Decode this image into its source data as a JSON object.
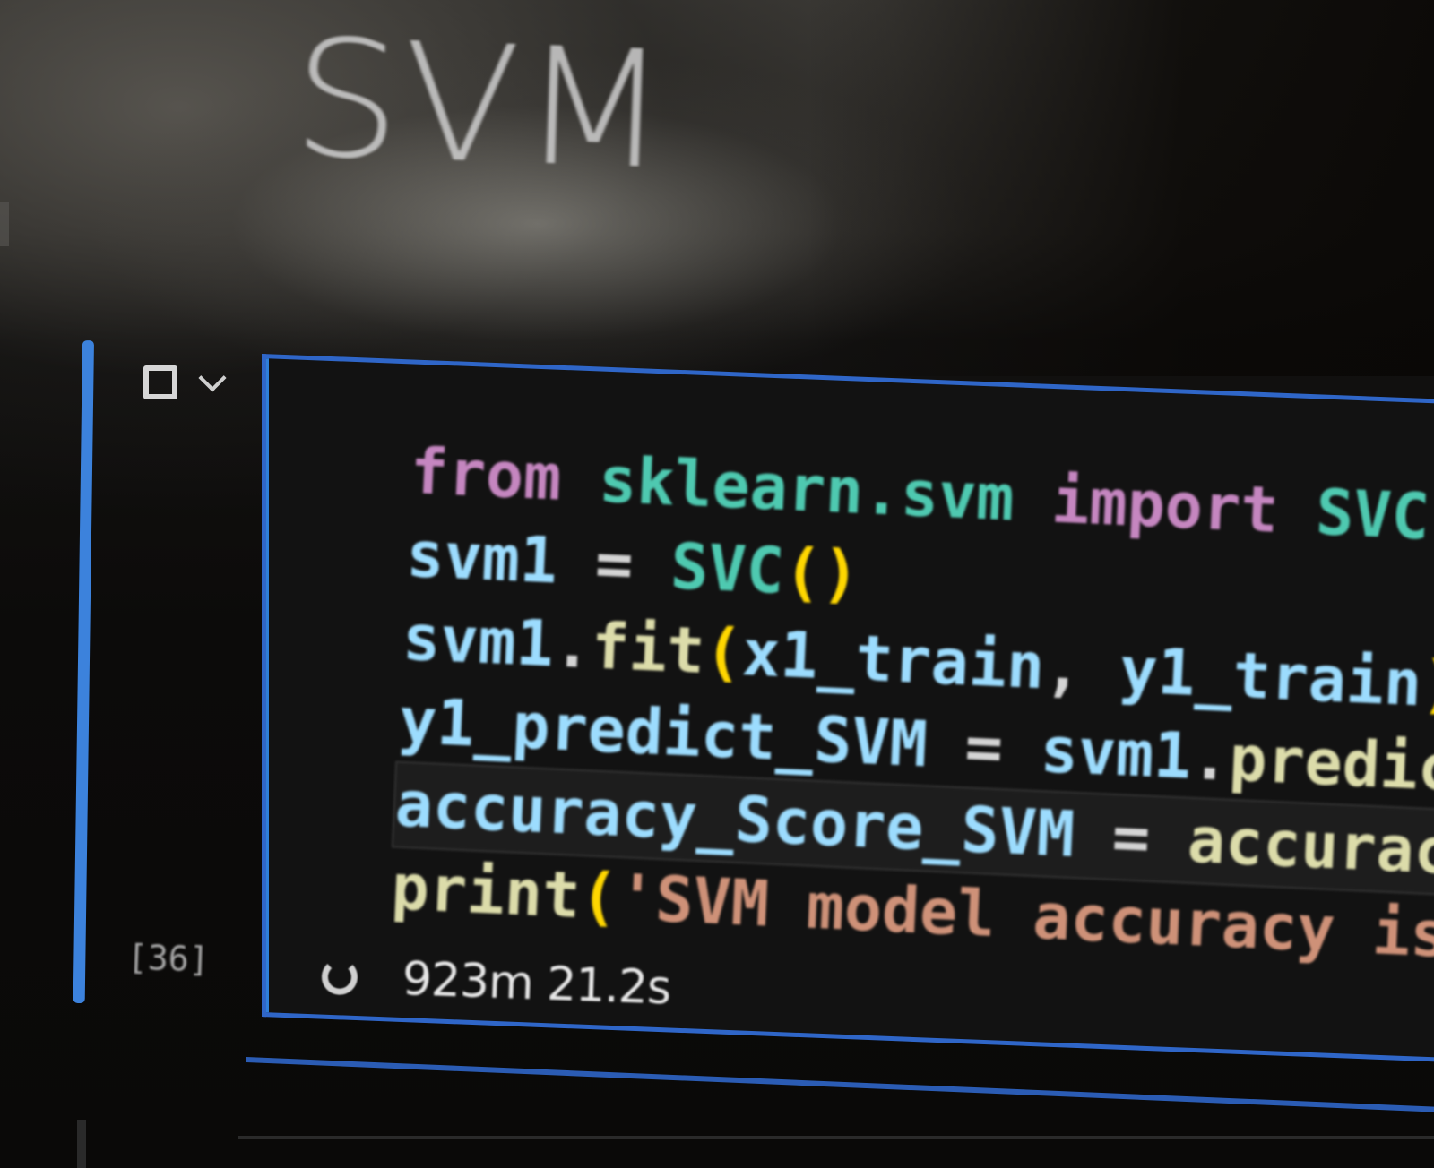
{
  "notebook": {
    "section_heading": "SVM",
    "cell": {
      "execution_count": "[36]",
      "elapsed_time": "923m 21.2s",
      "code_lines": [
        [
          {
            "t": "from",
            "c": "kw"
          },
          {
            "t": " ",
            "c": "op"
          },
          {
            "t": "sklearn.svm",
            "c": "mod"
          },
          {
            "t": " ",
            "c": "op"
          },
          {
            "t": "import",
            "c": "kw"
          },
          {
            "t": " ",
            "c": "op"
          },
          {
            "t": "SVC",
            "c": "cls"
          }
        ],
        [
          {
            "t": "svm1",
            "c": "var"
          },
          {
            "t": " = ",
            "c": "op"
          },
          {
            "t": "SVC",
            "c": "cls"
          },
          {
            "t": "()",
            "c": "paren"
          }
        ],
        [
          {
            "t": "svm1",
            "c": "var"
          },
          {
            "t": ".",
            "c": "op"
          },
          {
            "t": "fit",
            "c": "fn"
          },
          {
            "t": "(",
            "c": "paren"
          },
          {
            "t": "x1_train",
            "c": "var"
          },
          {
            "t": ", ",
            "c": "op"
          },
          {
            "t": "y1_train",
            "c": "var"
          },
          {
            "t": ")",
            "c": "paren"
          }
        ],
        [
          {
            "t": "y1_predict_SVM",
            "c": "var"
          },
          {
            "t": " = ",
            "c": "op"
          },
          {
            "t": "svm1",
            "c": "var"
          },
          {
            "t": ".",
            "c": "op"
          },
          {
            "t": "predict",
            "c": "fn"
          }
        ],
        [
          {
            "t": "accuracy_Score_SVM",
            "c": "var"
          },
          {
            "t": " = ",
            "c": "op"
          },
          {
            "t": "accuracy_",
            "c": "fn"
          }
        ],
        [
          {
            "t": "print",
            "c": "fn"
          },
          {
            "t": "(",
            "c": "paren"
          },
          {
            "t": "'SVM model accuracy is:",
            "c": "str"
          }
        ]
      ],
      "current_line_index": 4
    }
  },
  "icons": {
    "run_state": "stop-icon",
    "collapse": "chevron-down-icon",
    "status": "spinner-icon"
  },
  "colors": {
    "cell_border": "#2f66c8",
    "active_bar": "#3c82dc",
    "keyword": "#c586c0",
    "module": "#4ec9b0",
    "variable": "#9cdcfe",
    "function": "#dcdcaa",
    "paren": "#ffd700",
    "string": "#ce9178"
  }
}
